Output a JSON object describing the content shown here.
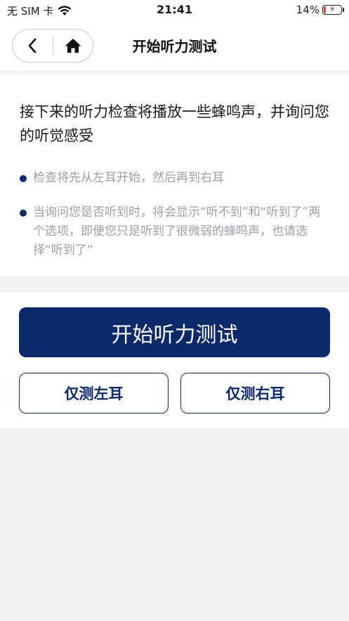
{
  "status_bar": {
    "carrier": "无 SIM 卡",
    "time": "21:41",
    "battery_percent": "14%",
    "battery_level": 0.14,
    "icons": [
      "wifi-icon",
      "battery-icon",
      "charging-bolt-icon"
    ]
  },
  "nav": {
    "title": "开始听力测试",
    "icons": [
      "back-chevron-icon",
      "home-icon"
    ]
  },
  "info": {
    "intro": "接下来的听力检查将播放一些蜂鸣声，并询问您的听觉感受",
    "bullets": [
      "检查将先从左耳开始，然后再到右耳",
      "当询问您是否听到时，将会显示“听不到”和“听到了”两个选项，即便您只是听到了很微弱的蜂鸣声，也请选择“听到了”"
    ]
  },
  "actions": {
    "start_label": "开始听力测试",
    "left_ear_label": "仅测左耳",
    "right_ear_label": "仅测右耳"
  },
  "colors": {
    "primary": "#0c2a6a",
    "bullet_text": "#9aa0ab",
    "background": "#f2f2f2",
    "battery_low": "#e53935"
  }
}
